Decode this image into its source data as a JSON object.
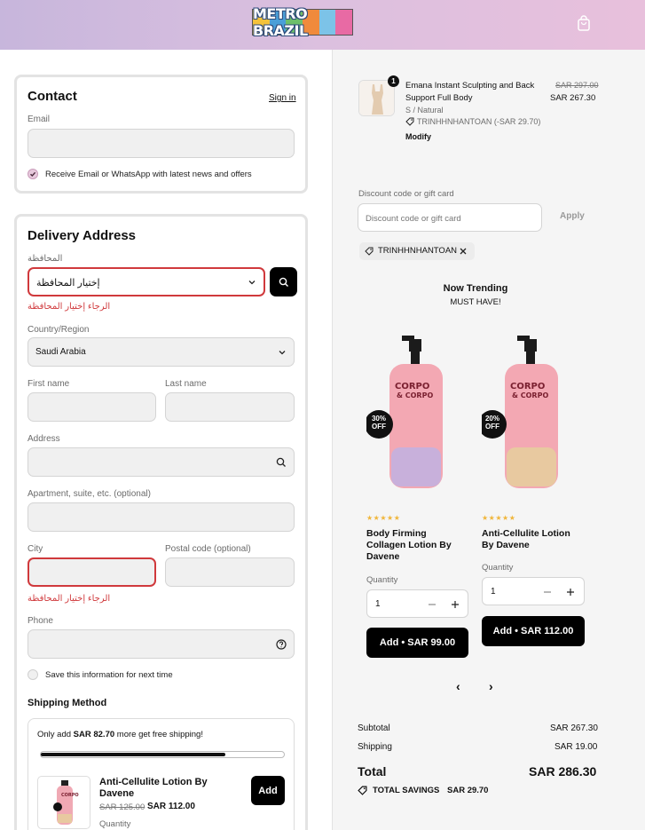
{
  "header": {
    "logo_text": "METRO BRAZIL",
    "logo_colors": [
      "#f4c23a",
      "#4a9fd8",
      "#6cbf6a",
      "#f08a3c",
      "#7cc3e8",
      "#e86aa4"
    ]
  },
  "contact": {
    "title": "Contact",
    "sign_in": "Sign in",
    "email_label": "Email",
    "email_value": "",
    "newsletter_label": "Receive Email or WhatsApp with latest news and offers"
  },
  "delivery": {
    "title": "Delivery Address",
    "governorate_label": "المحافظة",
    "governorate_value": "إختيار المحافظة",
    "governorate_error": "الرجاء إختيار المحافظة",
    "country_label": "Country/Region",
    "country_value": "Saudi Arabia",
    "first_name_label": "First name",
    "last_name_label": "Last name",
    "address_label": "Address",
    "apartment_label": "Apartment, suite, etc. (optional)",
    "city_label": "City",
    "city_error": "الرجاء إختيار المحافظة",
    "postal_label": "Postal code (optional)",
    "phone_label": "Phone",
    "save_info_label": "Save this information for next time"
  },
  "shipping": {
    "title": "Shipping Method",
    "free_ship_prefix": "Only add ",
    "free_ship_amount": "SAR 82.70",
    "free_ship_suffix": " more get free shipping!",
    "progress": 0.76,
    "upsell": {
      "name": "Anti-Cellulite Lotion By Davene",
      "old_price": "SAR 125.00",
      "price": "SAR 112.00",
      "add_label": "Add",
      "quantity_label": "Quantity"
    }
  },
  "order": {
    "item": {
      "badge": "1",
      "name": "Emana Instant Sculpting and Back Support Full Body",
      "variant": "S / Natural",
      "discount": "TRINHHNHANTOAN (-SAR 29.70)",
      "modify": "Modify",
      "old_price": "SAR 297.00",
      "price": "SAR 267.30"
    },
    "discount_label": "Discount code or gift card",
    "discount_placeholder": "Discount code or gift card",
    "apply_label": "Apply",
    "applied_code": "TRINHHNHANTOAN"
  },
  "trending": {
    "title": "Now Trending",
    "subtitle": "MUST HAVE!",
    "products": [
      {
        "badge": "30% OFF",
        "name": "Body Firming Collagen Lotion By Davene",
        "quantity_label": "Quantity",
        "quantity": "1",
        "add_label": "Add • SAR 99.00",
        "rating": 5,
        "stars": "★★★★★"
      },
      {
        "badge": "20% OFF",
        "name": "Anti-Cellulite Lotion By Davene",
        "quantity_label": "Quantity",
        "quantity": "1",
        "add_label": "Add • SAR 112.00",
        "rating": 4.5,
        "stars": "★★★★★"
      }
    ],
    "prev": "‹",
    "next": "›"
  },
  "summary": {
    "subtotal_label": "Subtotal",
    "subtotal": "SAR 267.30",
    "shipping_label": "Shipping",
    "shipping": "SAR 19.00",
    "total_label": "Total",
    "total": "SAR 286.30",
    "savings_label": "TOTAL SAVINGS",
    "savings": "SAR 29.70"
  },
  "colors": {
    "error": "#d0393c",
    "accent_pink": "#e7c9dc",
    "black": "#000000"
  },
  "icons": [
    "bag-icon",
    "search-icon",
    "chevron-down-icon",
    "help-icon",
    "tag-icon",
    "close-icon",
    "minus-icon",
    "plus-icon"
  ]
}
